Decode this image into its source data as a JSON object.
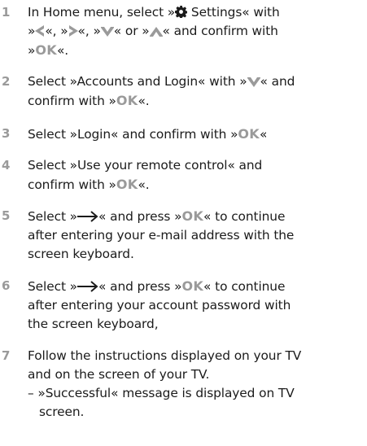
{
  "steps": [
    {
      "num": "1"
    },
    {
      "num": "2"
    },
    {
      "num": "3"
    },
    {
      "num": "4"
    },
    {
      "num": "5"
    },
    {
      "num": "6"
    },
    {
      "num": "7"
    }
  ],
  "text": {
    "s1a": "In Home menu, select »",
    "s1b": " Settings« with",
    "s1c": "»",
    "s1d": "«, »",
    "s1e": "«, »",
    "s1f": "« or »",
    "s1g": "« and confirm with",
    "s1h": "»",
    "s1i": "«.",
    "s2a": "Select »Accounts and Login« with »",
    "s2b": "« and",
    "s2c": "confirm with »",
    "s2d": "«.",
    "s3a": "Select »Login« and confirm with »",
    "s3b": "«",
    "s4a": "Select »Use your remote control« and",
    "s4b": "confirm with »",
    "s4c": "«.",
    "s5a": "Select »",
    "s5b": "« and press »",
    "s5c": "« to continue",
    "s5d": "after entering your e-mail address with the",
    "s5e": "screen keyboard.",
    "s6a": "Select »",
    "s6b": "« and press »",
    "s6c": "« to continue",
    "s6d": "after entering your account password with",
    "s6e": "the screen keyboard,",
    "s7a": "Follow the instructions displayed on your TV",
    "s7b": "and on the screen of your TV.",
    "s7c": "– »Successful« message is displayed on TV",
    "s7d": "screen.",
    "ok": "OK"
  },
  "icons": {
    "settings": "gear-icon",
    "left": "chevron-left-icon",
    "right": "chevron-right-icon",
    "down": "chevron-down-icon",
    "up": "chevron-up-icon",
    "arrow": "arrow-right-icon"
  },
  "colors": {
    "text": "#1b1b1b",
    "accent": "#9a9a9a"
  }
}
